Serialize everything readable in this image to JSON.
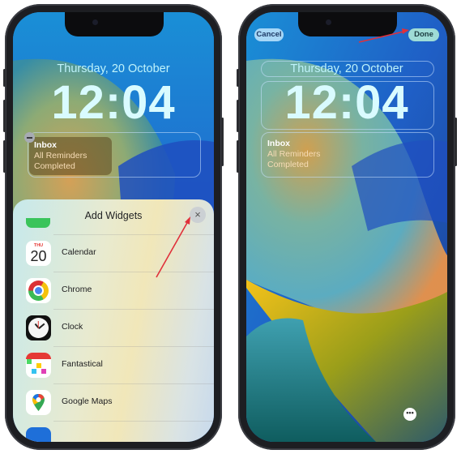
{
  "left_phone": {
    "lock_screen": {
      "date": "Thursday, 20 October",
      "time": "12:04",
      "widget": {
        "title": "Inbox",
        "lines": [
          "All Reminders",
          "Completed"
        ]
      }
    },
    "sheet": {
      "title": "Add Widgets",
      "close_icon": "×",
      "items": [
        {
          "label": "Calendar",
          "icon": "calendar-icon",
          "icon_day": "THU",
          "icon_date": "20"
        },
        {
          "label": "Chrome",
          "icon": "chrome-icon"
        },
        {
          "label": "Clock",
          "icon": "clock-icon"
        },
        {
          "label": "Fantastical",
          "icon": "fantastical-icon"
        },
        {
          "label": "Google Maps",
          "icon": "google-maps-icon"
        }
      ]
    }
  },
  "right_phone": {
    "cancel_label": "Cancel",
    "done_label": "Done",
    "lock_screen": {
      "date": "Thursday, 20 October",
      "time": "12:04",
      "widget": {
        "title": "Inbox",
        "lines": [
          "All Reminders",
          "Completed"
        ]
      }
    },
    "more_icon": "•••"
  },
  "colors": {
    "annotation_arrow": "#e0303a",
    "done_pill": "#9fdcd6",
    "cancel_pill": "#a7d7f7"
  }
}
